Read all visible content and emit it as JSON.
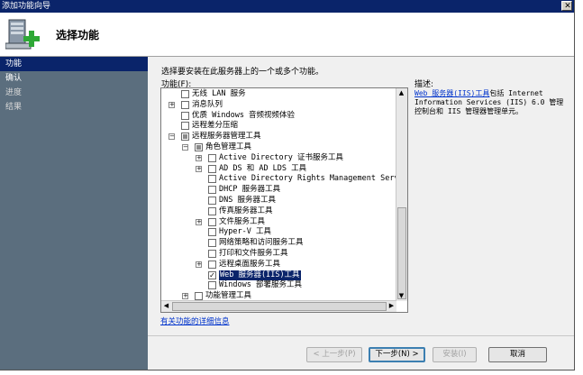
{
  "window": {
    "title": "添加功能向导"
  },
  "header": {
    "title": "选择功能"
  },
  "sidebar": {
    "items": [
      {
        "label": "功能",
        "state": "active"
      },
      {
        "label": "确认",
        "state": "normal"
      },
      {
        "label": "进度",
        "state": "dim"
      },
      {
        "label": "结果",
        "state": "dim"
      }
    ]
  },
  "main": {
    "prompt": "选择要安装在此服务器上的一个或多个功能。",
    "features_label": "功能(F):",
    "description_label": "描述:",
    "description_link": "Web 服务器(IIS)工具",
    "description_text": "包括 Internet Information Services (IIS) 6.0 管理控制台和 IIS 管理器管理单元。",
    "more_link": "有关功能的详细信息",
    "features": [
      {
        "label": "无线 LAN 服务",
        "level": 0,
        "expander": "",
        "checked": "no"
      },
      {
        "label": "消息队列",
        "level": 0,
        "expander": "+",
        "checked": "no"
      },
      {
        "label": "优质 Windows 音频视频体验",
        "level": 0,
        "expander": "",
        "checked": "no"
      },
      {
        "label": "远程差分压缩",
        "level": 0,
        "expander": "",
        "checked": "no"
      },
      {
        "label": "远程服务器管理工具",
        "level": 0,
        "expander": "-",
        "checked": "partial"
      },
      {
        "label": "角色管理工具",
        "level": 1,
        "expander": "-",
        "checked": "partial"
      },
      {
        "label": "Active Directory 证书服务工具",
        "level": 2,
        "expander": "+",
        "checked": "no"
      },
      {
        "label": "AD DS 和 AD LDS 工具",
        "level": 2,
        "expander": "+",
        "checked": "no"
      },
      {
        "label": "Active Directory Rights Management Services 工具",
        "level": 2,
        "expander": "",
        "checked": "no"
      },
      {
        "label": "DHCP 服务器工具",
        "level": 2,
        "expander": "",
        "checked": "no"
      },
      {
        "label": "DNS 服务器工具",
        "level": 2,
        "expander": "",
        "checked": "no"
      },
      {
        "label": "传真服务器工具",
        "level": 2,
        "expander": "",
        "checked": "no"
      },
      {
        "label": "文件服务工具",
        "level": 2,
        "expander": "+",
        "checked": "no"
      },
      {
        "label": "Hyper-V 工具",
        "level": 2,
        "expander": "",
        "checked": "no"
      },
      {
        "label": "网络策略和访问服务工具",
        "level": 2,
        "expander": "",
        "checked": "no"
      },
      {
        "label": "打印和文件服务工具",
        "level": 2,
        "expander": "",
        "checked": "no"
      },
      {
        "label": "远程桌面服务工具",
        "level": 2,
        "expander": "+",
        "checked": "no"
      },
      {
        "label": "Web 服务器(IIS)工具",
        "level": 2,
        "expander": "",
        "checked": "yes",
        "selected": true
      },
      {
        "label": "Windows 部署服务工具",
        "level": 2,
        "expander": "",
        "checked": "no"
      },
      {
        "label": "功能管理工具",
        "level": 1,
        "expander": "+",
        "checked": "no"
      }
    ]
  },
  "buttons": {
    "previous": "< 上一步(P)",
    "next": "下一步(N) >",
    "install": "安装(I)",
    "cancel": "取消"
  },
  "colors": {
    "titlebar": "#0a246a",
    "sidebar": "#5b6e7e",
    "selection": "#0a246a",
    "link": "#0033cc"
  }
}
